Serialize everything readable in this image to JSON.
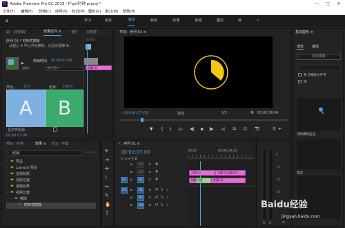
{
  "app": {
    "title": "Adobe Premiere Pro CC 2019 - F:\\pr\\时钟.prproj *",
    "icon": "Pr"
  },
  "window_controls": [
    "—",
    "□",
    "✕"
  ],
  "menu": [
    "文件(F)",
    "编辑(E)",
    "剪辑(C)",
    "序列(S)",
    "标记(M)",
    "图形(G)",
    "窗口(W)",
    "帮助(H)"
  ],
  "workspaces": {
    "home": "⌂",
    "items": [
      "学习",
      "组件",
      "编辑",
      "颜色",
      "效果",
      "音频",
      "图形",
      "库"
    ],
    "more": "»"
  },
  "effect_controls": {
    "tabs": [
      "源：(无剪辑)",
      "效果控件 ≡",
      "音频剪辑混合器：序列",
      "元数据"
    ],
    "sequence": "序列 01 * 时钟式擦除",
    "description": "从圆心 A 中心开始擦除，以显示图像 B。",
    "play_icon": "▶",
    "duration_label": "持续时间",
    "duration_value": "00:00:01:00",
    "alignment_label": "对齐：",
    "alignment_value": "中心切入",
    "start_label": "开始：",
    "start_value": "0.0",
    "end_label": "结束：",
    "end_value": "100.0",
    "thumb_a": "A",
    "thumb_b": "B",
    "show_actual_label": "显示实际源",
    "timecode": "00:00:07:00",
    "clip_label": "字幕 01",
    "mini_ruler": "00:00"
  },
  "program_monitor": {
    "title": "节目：序列 01 ≡",
    "timecode": "00:00:07:00",
    "fit": "适合",
    "resolution": "1/2",
    "duration": "00:00:56:04",
    "wrench_icon": "wrench-icon",
    "clock_color": "#f2c811",
    "controls": [
      "▼",
      "{",
      "}",
      "|←",
      "◀|",
      "▶",
      "|▶",
      "→|",
      "⊞",
      "⊟",
      "📷"
    ]
  },
  "essential_graphics": {
    "title": "基本图形 ≡",
    "tabs": [
      "浏览",
      "编辑"
    ],
    "button": "未的模板",
    "search_placeholder": "",
    "checkbox1": "我 音模板文件夹",
    "checkbox2": "库",
    "item1": "持续模板出品",
    "item2": "备案"
  },
  "project": {
    "tabs": [
      "项目：时钟",
      "效果 ≡",
      "标记",
      "字幕"
    ],
    "search": "时钟",
    "tree": [
      {
        "label": "预设",
        "indent": 0
      },
      {
        "label": "Lumetri 预设",
        "indent": 0
      },
      {
        "label": "音频效果",
        "indent": 0
      },
      {
        "label": "音频过渡",
        "indent": 0
      },
      {
        "label": "视频效果",
        "indent": 0
      },
      {
        "label": "视频过渡",
        "indent": 0
      },
      {
        "label": "擦除",
        "indent": 1
      },
      {
        "label": "时钟式擦除",
        "indent": 2
      }
    ]
  },
  "timeline": {
    "title": "序列 01 ≡",
    "timecode": "00:00:07:00",
    "ruler": [
      "00:00",
      "00:00:29:23"
    ],
    "tracks": [
      {
        "name": "V3",
        "lock": "🔒",
        "sync": "⇆",
        "eye": "👁"
      },
      {
        "name": "V2",
        "lock": "🔒",
        "sync": "⇆",
        "eye": "👁"
      },
      {
        "name": "V1",
        "lock": "🔒",
        "sync": "⇆",
        "eye": "👁"
      },
      {
        "name": "A1",
        "lock": "🔒",
        "sync": "⇆",
        "m": "M",
        "s": "S"
      },
      {
        "name": "A2",
        "lock": "🔒",
        "sync": "⇆",
        "m": "M",
        "s": "S"
      },
      {
        "name": "A3",
        "lock": "🔒",
        "sync": "⇆",
        "m": "M",
        "s": "S"
      }
    ],
    "source_patch_v": "V1",
    "source_patch_a": "A1",
    "clips": {
      "v2_a": "字幕 01",
      "v2_b": "字幕 01 复制 01",
      "v1_a": "字幕",
      "v1_transition": "时钟",
      "v1_b": "字幕 01"
    }
  },
  "audio_meter": {
    "labels": [
      "0",
      "-12",
      "-24",
      "-36",
      "-48",
      "dB"
    ],
    "solo": [
      "S",
      "S"
    ]
  },
  "watermark": {
    "brand": "Baidu经验",
    "url": "jingyan.baidu.com"
  }
}
